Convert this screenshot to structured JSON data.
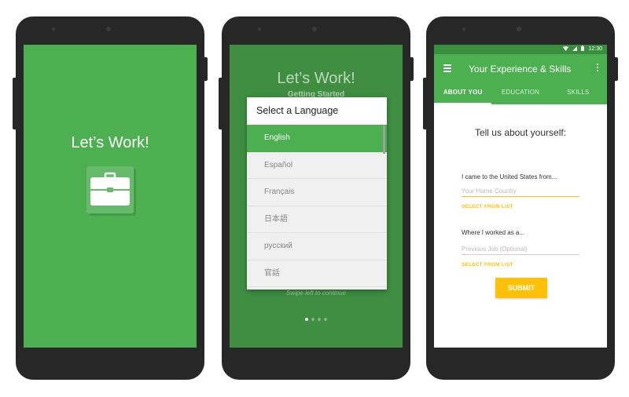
{
  "colors": {
    "brand_green": "#4caf50",
    "dark_green": "#3f8e42",
    "status_green": "#388e3c",
    "accent": "#ffc107",
    "device": "#272727"
  },
  "splash": {
    "title": "Let’s Work!",
    "icon": "briefcase-icon"
  },
  "language_screen": {
    "title": "Let’s Work!",
    "subtitle": "Getting Started",
    "dialog_title": "Select a Language",
    "languages": [
      "English",
      "Español",
      "Français",
      "日本語",
      "русский",
      "官話"
    ],
    "selected": "English",
    "swipe_hint": "Swipe left to continue",
    "page_count": 4,
    "current_page": 1
  },
  "profile_screen": {
    "status_time": "12:30",
    "app_title": "Your Experience & Skills",
    "tabs": [
      "ABOUT YOU",
      "EDUCATION",
      "SKILLS"
    ],
    "active_tab": "ABOUT YOU",
    "heading": "Tell us about yourself:",
    "fields": [
      {
        "label": "I came to the United States from...",
        "placeholder": "Your Home Country",
        "link": "SELECT FROM LIST"
      },
      {
        "label": "Where I worked as a...",
        "placeholder": "Previous Job (Optional)",
        "link": "SELECT FROM LIST"
      }
    ],
    "submit_label": "SUBMIT"
  }
}
